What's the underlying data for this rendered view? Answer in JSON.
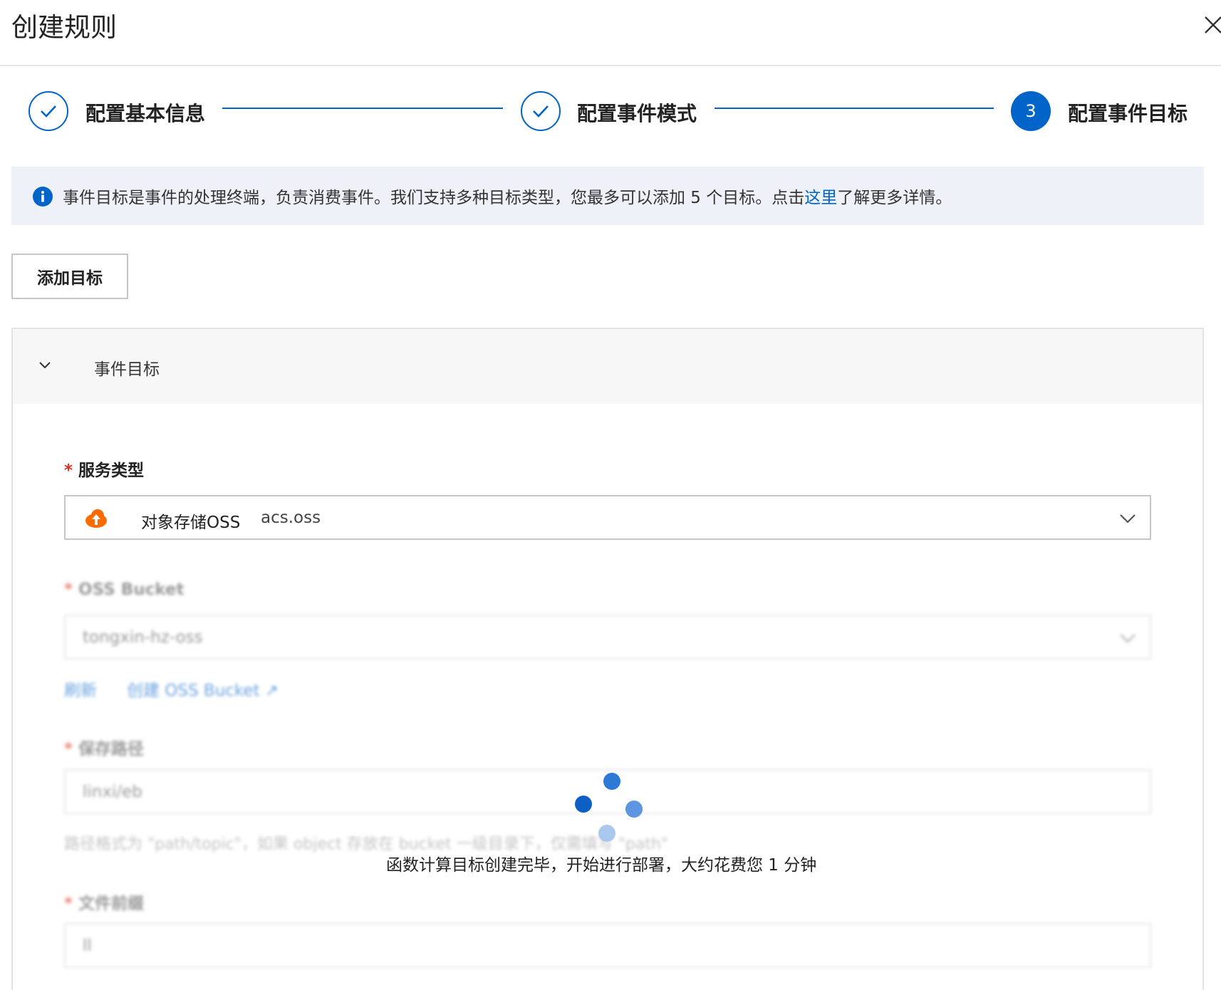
{
  "dialog": {
    "title": "创建规则"
  },
  "steps": [
    {
      "label": "配置基本信息",
      "status": "done"
    },
    {
      "label": "配置事件模式",
      "status": "done"
    },
    {
      "label": "配置事件目标",
      "status": "active",
      "number": "3"
    }
  ],
  "alert": {
    "text_before": "事件目标是事件的处理终端，负责消费事件。我们支持多种目标类型，您最多可以添加 5 个目标。点击",
    "link": "这里",
    "text_after": "了解更多详情。"
  },
  "add_target_button": "添加目标",
  "target_panel": {
    "title": "事件目标",
    "service_type": {
      "label": "服务类型",
      "selected_name": "对象存储OSS",
      "selected_code": "acs.oss"
    },
    "oss_bucket": {
      "label": "OSS Bucket",
      "value": "tongxin-hz-oss",
      "refresh": "刷新",
      "create": "创建 OSS Bucket"
    },
    "save_path": {
      "label": "保存路径",
      "value": "linxi/eb",
      "help": "路径格式为 \"path/topic\"，如果 object 存放在 bucket 一级目录下，仅需填写 \"path\""
    },
    "file_prefix": {
      "label": "文件前缀",
      "value": "ll"
    }
  },
  "loading": {
    "message": "函数计算目标创建完毕，开始进行部署，大约花费您 1 分钟"
  },
  "colors": {
    "primary": "#0064c8",
    "required": "#d93026",
    "oss_orange": "#ff6a00"
  }
}
